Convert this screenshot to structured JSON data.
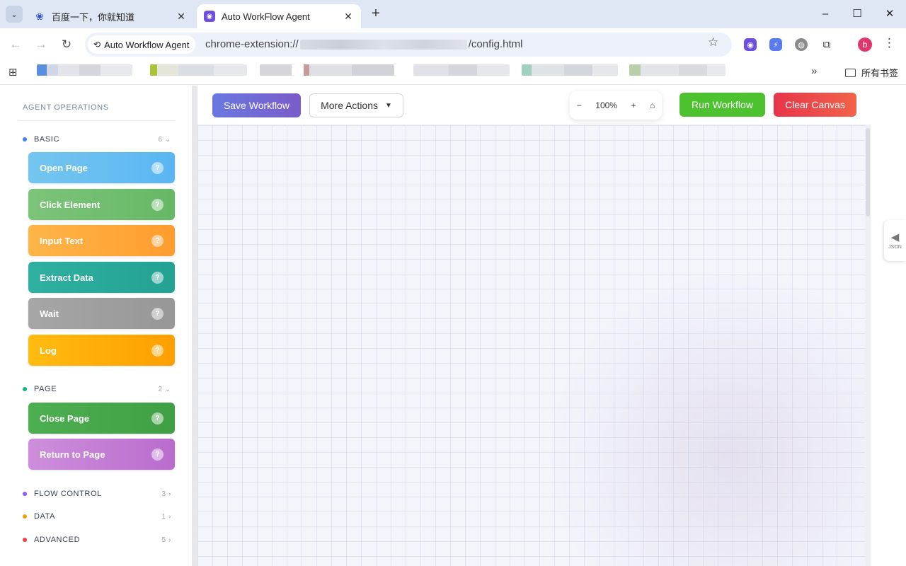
{
  "browser": {
    "tabs": [
      {
        "title": "百度一下，你就知道",
        "favicon": "baidu-paw-icon",
        "active": false
      },
      {
        "title": "Auto WorkFlow Agent",
        "favicon": "agent-robot-icon",
        "active": true
      }
    ],
    "address": {
      "site_chip": "Auto Workflow Agent",
      "url_prefix": "chrome-extension://",
      "url_suffix": "/config.html"
    },
    "bookmarks": {
      "folder_label": "所有书签",
      "more": "»"
    },
    "profile_initial": "b",
    "window_controls": {
      "minimize": "–",
      "maximize": "☐",
      "close": "✕"
    }
  },
  "sidebar": {
    "title": "AGENT OPERATIONS",
    "groups": [
      {
        "label": "BASIC",
        "count": "6",
        "expanded": true,
        "dot_color": "#3b82f6",
        "items": [
          {
            "label": "Open Page",
            "help": "?",
            "color": "#5bbcf0"
          },
          {
            "label": "Click Element",
            "help": "?",
            "color": "#6fbf6e"
          },
          {
            "label": "Input Text",
            "help": "?",
            "color": "#ffa93a"
          },
          {
            "label": "Extract Data",
            "help": "?",
            "color": "#2aa89a"
          },
          {
            "label": "Wait",
            "help": "?",
            "color": "#9e9e9e"
          },
          {
            "label": "Log",
            "help": "?",
            "color": "#ffaa00"
          }
        ]
      },
      {
        "label": "PAGE",
        "count": "2",
        "expanded": true,
        "dot_color": "#10b981",
        "items": [
          {
            "label": "Close Page",
            "help": "?",
            "color": "#43a047"
          },
          {
            "label": "Return to Page",
            "help": "?",
            "color": "#c17fd6"
          }
        ]
      },
      {
        "label": "FLOW CONTROL",
        "count": "3",
        "expanded": false,
        "dot_color": "#8b5cf6",
        "items": []
      },
      {
        "label": "DATA",
        "count": "1",
        "expanded": false,
        "dot_color": "#f59e0b",
        "items": []
      },
      {
        "label": "ADVANCED",
        "count": "5",
        "expanded": false,
        "dot_color": "#ef4444",
        "items": []
      }
    ]
  },
  "toolbar": {
    "save_label": "Save Workflow",
    "more_label": "More Actions",
    "more_caret": "▼",
    "zoom_out": "−",
    "zoom_level": "100%",
    "zoom_in": "+",
    "zoom_reset": "⌂",
    "run_label": "Run Workflow",
    "clear_label": "Clear Canvas"
  },
  "json_panel": {
    "toggle_label": "JSON",
    "arrow": "◀"
  }
}
